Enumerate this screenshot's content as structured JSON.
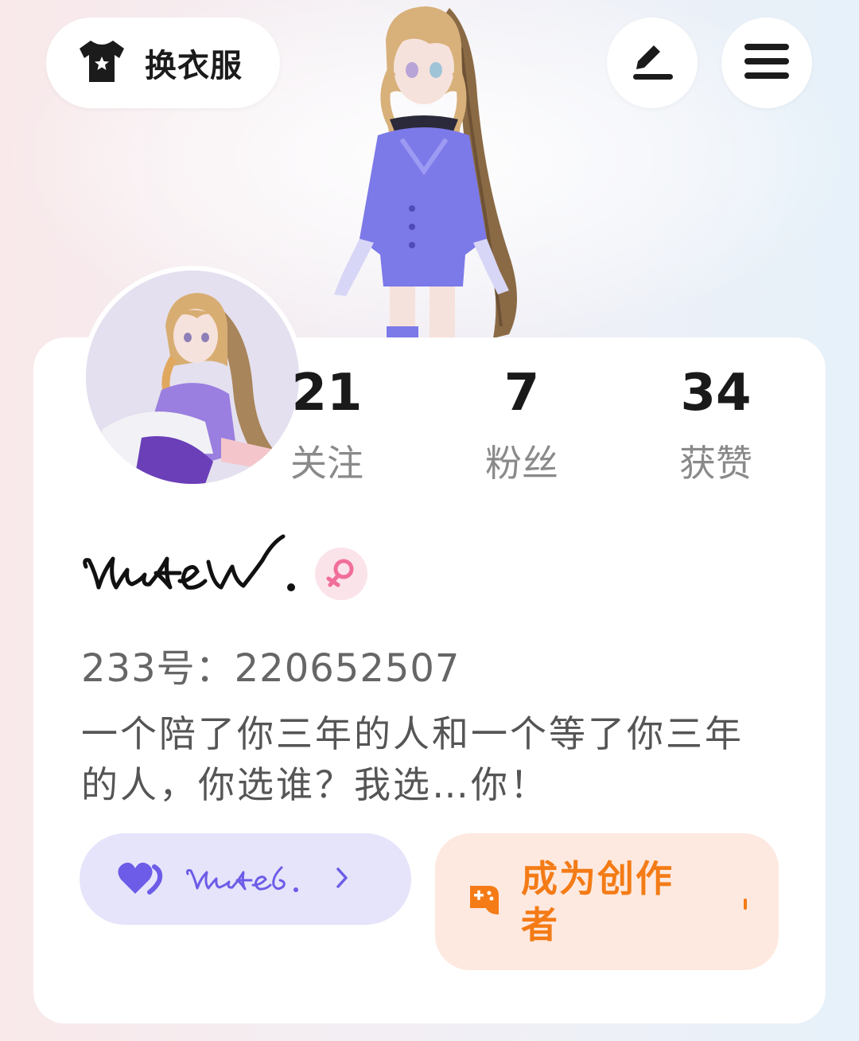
{
  "header": {
    "outfit_label": "换衣服",
    "outfit_icon": "shirt-icon",
    "edit_icon": "pencil-icon",
    "menu_icon": "hamburger-menu-icon"
  },
  "profile": {
    "stats": [
      {
        "value": "21",
        "label": "关注"
      },
      {
        "value": "7",
        "label": "粉丝"
      },
      {
        "value": "34",
        "label": "获赞"
      }
    ],
    "gender_icon": "female-icon",
    "uid": "233号：220652507",
    "bio": "一个陪了你三年的人和一个等了你三年的人，你选谁？我选…你！"
  },
  "actions": {
    "fan_club_icon": "hearts-icon",
    "fan_club_arrow": "chevron-right-icon",
    "creator_label": "成为创作者",
    "creator_icon": "gamepad-icon"
  },
  "colors": {
    "accent_purple": "#6c5ce7",
    "accent_orange": "#f47b16",
    "gender_pink": "#f06f9a"
  }
}
